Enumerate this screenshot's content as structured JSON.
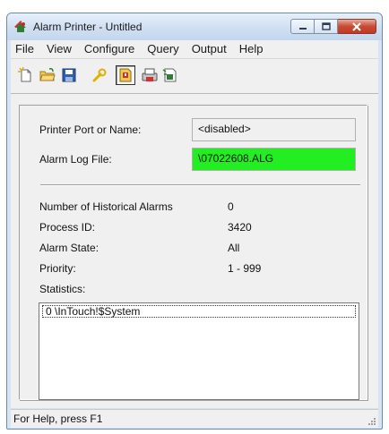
{
  "window": {
    "title": "Alarm Printer - Untitled"
  },
  "menu": [
    "File",
    "View",
    "Configure",
    "Query",
    "Output",
    "Help"
  ],
  "toolbar": {
    "icons": [
      "new-icon",
      "open-icon",
      "save-icon",
      "configure-icon",
      "alarm-print-icon",
      "query-icon",
      "output-icon"
    ]
  },
  "settings": {
    "printer_label": "Printer Port or Name:",
    "printer_value": "<disabled>",
    "log_label": "Alarm Log File:",
    "log_value": "\\07022608.ALG",
    "log_color": "#22ee22"
  },
  "info": {
    "historical_label": "Number of Historical Alarms",
    "historical_value": "0",
    "pid_label": "Process ID:",
    "pid_value": "3420",
    "state_label": "Alarm State:",
    "state_value": "All",
    "priority_label": "Priority:",
    "priority_value": "1 - 999",
    "statistics_label": "Statistics:"
  },
  "statistics": [
    "0 \\InTouch!$System"
  ],
  "status": {
    "text": "For Help, press F1"
  }
}
